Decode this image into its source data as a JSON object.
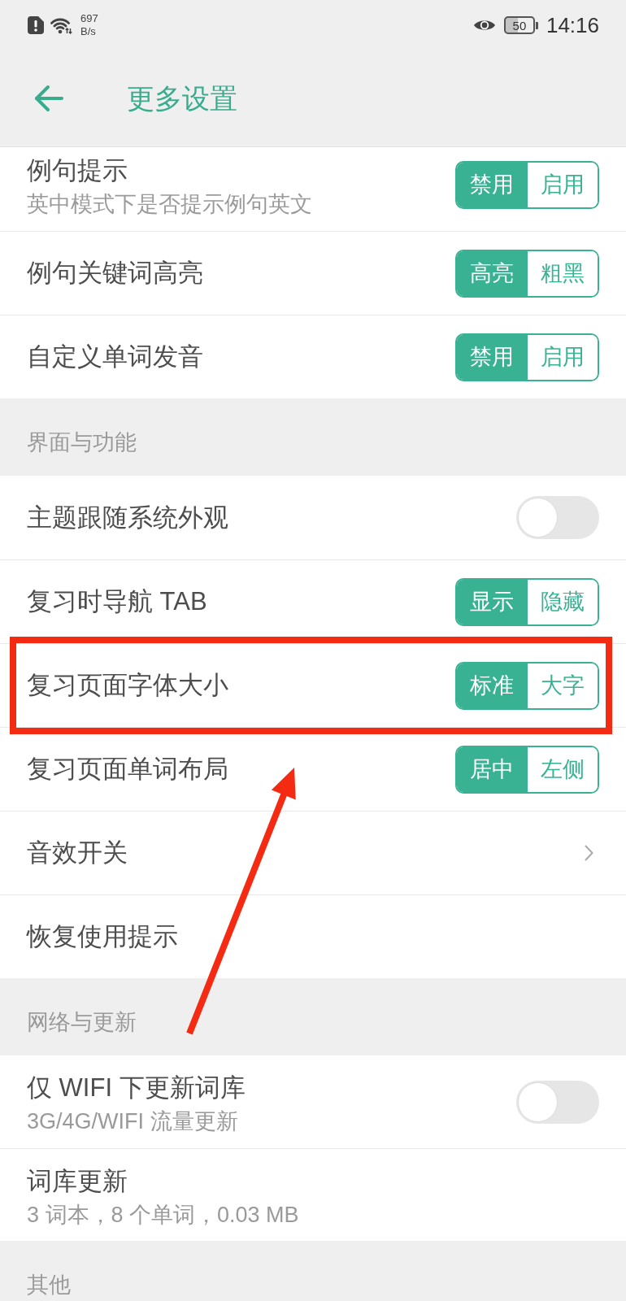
{
  "status_bar": {
    "network_speed": {
      "value": "697",
      "unit": "B/s"
    },
    "battery": "50",
    "time": "14:16"
  },
  "header": {
    "title": "更多设置"
  },
  "groups": [
    {
      "items": [
        {
          "kind": "segmented",
          "label": "例句提示",
          "subtitle": "英中模式下是否提示例句英文",
          "highlighted": false,
          "options": [
            {
              "label": "禁用",
              "selected": true
            },
            {
              "label": "启用",
              "selected": false
            }
          ]
        },
        {
          "kind": "segmented",
          "label": "例句关键词高亮",
          "highlighted": false,
          "options": [
            {
              "label": "高亮",
              "selected": true
            },
            {
              "label": "粗黑",
              "selected": false
            }
          ]
        },
        {
          "kind": "segmented",
          "label": "自定义单词发音",
          "highlighted": false,
          "options": [
            {
              "label": "禁用",
              "selected": true
            },
            {
              "label": "启用",
              "selected": false
            }
          ]
        }
      ]
    },
    {
      "title": "界面与功能",
      "items": [
        {
          "kind": "switch",
          "label": "主题跟随系统外观",
          "on": false,
          "highlighted": false
        },
        {
          "kind": "segmented",
          "label": "复习时导航 TAB",
          "highlighted": false,
          "options": [
            {
              "label": "显示",
              "selected": true
            },
            {
              "label": "隐藏",
              "selected": false
            }
          ]
        },
        {
          "kind": "segmented",
          "label": "复习页面字体大小",
          "highlighted": true,
          "options": [
            {
              "label": "标准",
              "selected": true
            },
            {
              "label": "大字",
              "selected": false
            }
          ]
        },
        {
          "kind": "segmented",
          "label": "复习页面单词布局",
          "highlighted": false,
          "options": [
            {
              "label": "居中",
              "selected": true
            },
            {
              "label": "左侧",
              "selected": false
            }
          ]
        },
        {
          "kind": "link",
          "label": "音效开关",
          "highlighted": false
        },
        {
          "kind": "plain",
          "label": "恢复使用提示",
          "highlighted": false
        }
      ]
    },
    {
      "title": "网络与更新",
      "items": [
        {
          "kind": "switch",
          "label": "仅 WIFI 下更新词库",
          "subtitle": "3G/4G/WIFI 流量更新",
          "on": false,
          "highlighted": false
        },
        {
          "kind": "plain",
          "label": "词库更新",
          "subtitle": "3 词本，8 个单词，0.03 MB",
          "highlighted": false
        }
      ]
    },
    {
      "title": "其他"
    }
  ]
}
